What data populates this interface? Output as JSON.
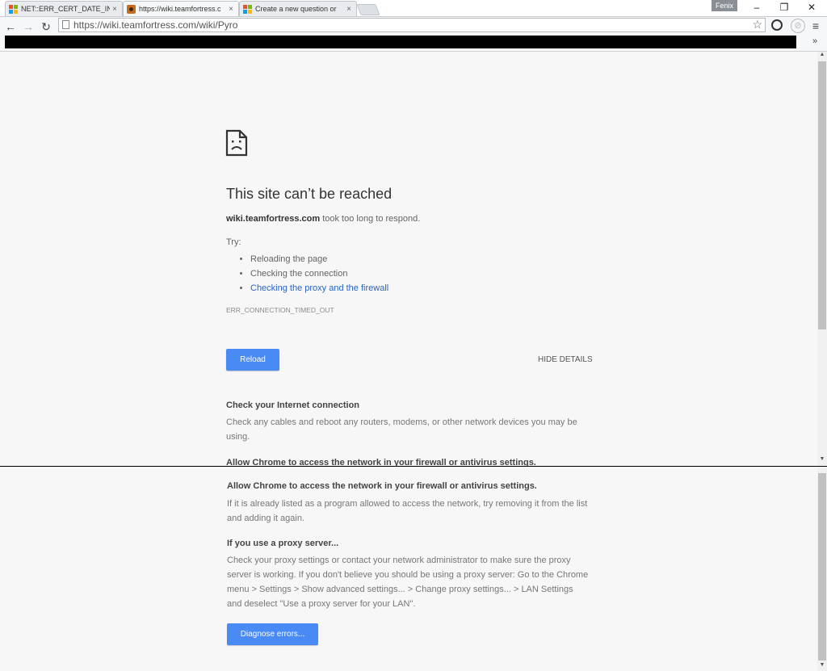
{
  "tabs": [
    {
      "title": "NET::ERR_CERT_DATE_IN",
      "close": "×",
      "icon": "windows-logo-icon"
    },
    {
      "title": "https://wiki.teamfortress.c",
      "close": "×",
      "icon": "tf2-favicon-icon"
    },
    {
      "title": "Create a new question or",
      "close": "×",
      "icon": "windows-logo-icon"
    }
  ],
  "window": {
    "user": "Fenix",
    "minimize": "–",
    "restore": "❐",
    "close": "✕"
  },
  "toolbar": {
    "back": "←",
    "forward": "→",
    "reload": "↻",
    "url": "https://wiki.teamfortress.com/wiki/Pyro",
    "star": "☆",
    "menu": "≡"
  },
  "bookmarks": {
    "overflow": "»"
  },
  "error": {
    "title": "This site can’t be reached",
    "host": "wiki.teamfortress.com",
    "message": " took too long to respond.",
    "try_label": "Try:",
    "suggestions": [
      "Reloading the page",
      "Checking the connection",
      "Checking the proxy and the firewall"
    ],
    "code": "ERR_CONNECTION_TIMED_OUT",
    "reload_button": "Reload",
    "details_button": "HIDE DETAILS",
    "sections": [
      {
        "heading": "Check your Internet connection",
        "body": "Check any cables and reboot any routers, modems, or other network devices you may be using."
      },
      {
        "heading": "Allow Chrome to access the network in your firewall or antivirus settings.",
        "body": "If it is already listed as a program allowed to access the network, try removing it from the list and adding it again."
      },
      {
        "heading": "If you use a proxy server...",
        "body": "Check your proxy settings or contact your network administrator to make sure the proxy server is working. If you don't believe you should be using a proxy server: Go to the Chrome menu > Settings > Show advanced settings... > Change proxy settings... > LAN Settings and deselect \"Use a proxy server for your LAN\"."
      }
    ],
    "diagnose_button": "Diagnose errors..."
  },
  "colors": {
    "accent": "#4a8af4",
    "link": "#2a63c3"
  }
}
